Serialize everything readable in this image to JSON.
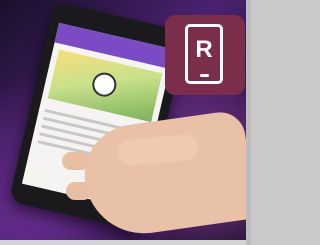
{
  "logo": {
    "letter": "R",
    "icon": "smartphone-icon",
    "tile_color": "#7a2e49"
  },
  "colors": {
    "background_purple": "#4a2370",
    "app_bar": "#7a4bc4"
  }
}
